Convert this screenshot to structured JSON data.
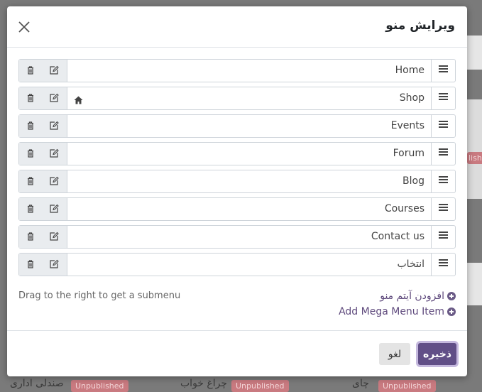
{
  "dialog": {
    "title": "ویرایش منو",
    "close_icon": "close-icon"
  },
  "menu_items": [
    {
      "label": "Home",
      "icon": ""
    },
    {
      "label": "Shop",
      "icon": "home-icon"
    },
    {
      "label": "Events",
      "icon": ""
    },
    {
      "label": "Forum",
      "icon": ""
    },
    {
      "label": "Blog",
      "icon": ""
    },
    {
      "label": "Courses",
      "icon": ""
    },
    {
      "label": "Contact us",
      "icon": ""
    },
    {
      "label": "انتخاب",
      "icon": ""
    }
  ],
  "hint": "Drag to the right to get a submenu",
  "add_menu_item": "افزودن آیتم منو",
  "add_mega_menu_item": "Add Mega Menu Item",
  "footer": {
    "save_label": "ذخیره",
    "cancel_label": "لغو"
  },
  "background": {
    "tags": [
      "Unpublished",
      "Unpublished",
      "Unpublished",
      "lishe"
    ],
    "texts": [
      "صندلی اداری",
      "چراغ خواب",
      "چای"
    ]
  },
  "colors": {
    "primary": "#614f87",
    "link": "#5f4a7d",
    "overlay": "#7a7a7a"
  }
}
